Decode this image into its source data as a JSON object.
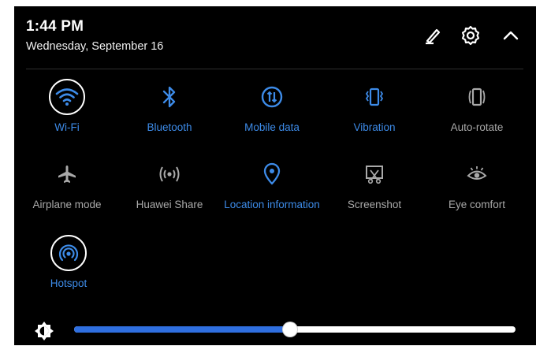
{
  "status": {
    "time": "1:44 PM",
    "date": "Wednesday, September 16"
  },
  "header_actions": [
    {
      "name": "edit-icon"
    },
    {
      "name": "settings-icon"
    },
    {
      "name": "collapse-icon"
    }
  ],
  "tiles": {
    "wifi": {
      "label": "Wi-Fi",
      "active": true,
      "icon": "wifi-icon"
    },
    "bluetooth": {
      "label": "Bluetooth",
      "active": true,
      "icon": "bluetooth-icon"
    },
    "mobile_data": {
      "label": "Mobile data",
      "active": true,
      "icon": "mobile-data-icon"
    },
    "vibration": {
      "label": "Vibration",
      "active": true,
      "icon": "vibration-icon"
    },
    "auto_rotate": {
      "label": "Auto-rotate",
      "active": false,
      "icon": "auto-rotate-icon"
    },
    "airplane": {
      "label": "Airplane mode",
      "active": false,
      "icon": "airplane-icon"
    },
    "huawei_share": {
      "label": "Huawei Share",
      "active": false,
      "icon": "huawei-share-icon"
    },
    "location": {
      "label": "Location information",
      "active": true,
      "icon": "location-icon"
    },
    "screenshot": {
      "label": "Screenshot",
      "active": false,
      "icon": "screenshot-icon"
    },
    "eye_comfort": {
      "label": "Eye comfort",
      "active": false,
      "icon": "eye-comfort-icon"
    },
    "hotspot": {
      "label": "Hotspot",
      "active": true,
      "icon": "hotspot-icon"
    }
  },
  "brightness": {
    "level_percent": 49,
    "icon": "brightness-icon"
  },
  "colors": {
    "active": "#3d8be8",
    "inactive": "#a9a9a9",
    "slider_fill": "#2f6fe0",
    "background": "#000000"
  }
}
